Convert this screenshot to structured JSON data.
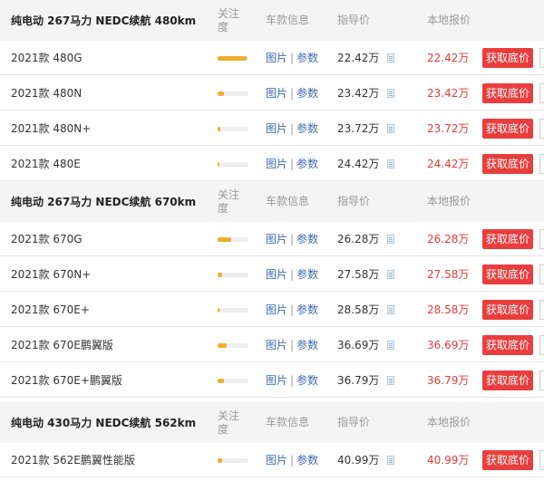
{
  "columns": {
    "attention": "关注度",
    "info": "车款信息",
    "guide": "指导价",
    "local": "本地报价"
  },
  "links": {
    "pics": "图片",
    "params": "参数",
    "sep": "|"
  },
  "button_label": "获取底价",
  "bar_color": "#f2ad2c",
  "button_color": "#ea3e3e",
  "groups": [
    {
      "title": "纯电动 267马力 NEDC续航 480km",
      "rows": [
        {
          "name": "2021款 480G",
          "attention": 0.95,
          "guide": "22.42万",
          "local": "22.42万"
        },
        {
          "name": "2021款 480N",
          "attention": 0.2,
          "guide": "23.42万",
          "local": "23.42万"
        },
        {
          "name": "2021款 480N+",
          "attention": 0.1,
          "guide": "23.72万",
          "local": "23.72万"
        },
        {
          "name": "2021款 480E",
          "attention": 0.05,
          "guide": "24.42万",
          "local": "24.42万"
        }
      ]
    },
    {
      "title": "纯电动 267马力 NEDC续航 670km",
      "rows": [
        {
          "name": "2021款 670G",
          "attention": 0.45,
          "guide": "26.28万",
          "local": "26.28万"
        },
        {
          "name": "2021款 670N+",
          "attention": 0.15,
          "guide": "27.58万",
          "local": "27.58万"
        },
        {
          "name": "2021款 670E+",
          "attention": 0.05,
          "guide": "28.58万",
          "local": "28.58万"
        },
        {
          "name": "2021款 670E鹏翼版",
          "attention": 0.3,
          "guide": "36.69万",
          "local": "36.69万"
        },
        {
          "name": "2021款 670E+鹏翼版",
          "attention": 0.2,
          "guide": "36.79万",
          "local": "36.79万"
        }
      ]
    },
    {
      "title": "纯电动 430马力 NEDC续航 562km",
      "rows": [
        {
          "name": "2021款 562E鹏翼性能版",
          "attention": 0.15,
          "guide": "40.99万",
          "local": "40.99万"
        }
      ]
    }
  ]
}
